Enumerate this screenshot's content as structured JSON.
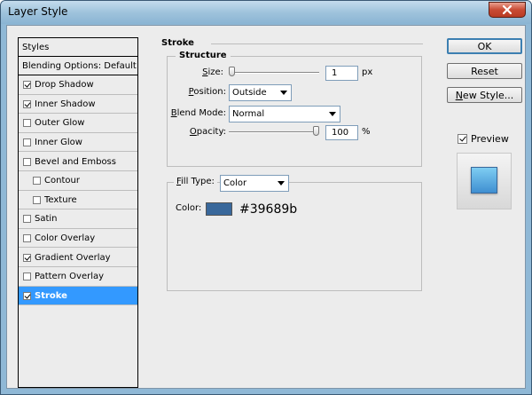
{
  "window": {
    "title": "Layer Style"
  },
  "sidebar": {
    "header": "Styles",
    "items": [
      {
        "label": "Blending Options: Default",
        "checkbox": false,
        "checked": false,
        "indent": 0,
        "selected": false
      },
      {
        "label": "Drop Shadow",
        "checkbox": true,
        "checked": true,
        "indent": 0,
        "selected": false
      },
      {
        "label": "Inner Shadow",
        "checkbox": true,
        "checked": true,
        "indent": 0,
        "selected": false
      },
      {
        "label": "Outer Glow",
        "checkbox": true,
        "checked": false,
        "indent": 0,
        "selected": false
      },
      {
        "label": "Inner Glow",
        "checkbox": true,
        "checked": false,
        "indent": 0,
        "selected": false
      },
      {
        "label": "Bevel and Emboss",
        "checkbox": true,
        "checked": false,
        "indent": 0,
        "selected": false
      },
      {
        "label": "Contour",
        "checkbox": true,
        "checked": false,
        "indent": 1,
        "selected": false
      },
      {
        "label": "Texture",
        "checkbox": true,
        "checked": false,
        "indent": 1,
        "selected": false
      },
      {
        "label": "Satin",
        "checkbox": true,
        "checked": false,
        "indent": 0,
        "selected": false
      },
      {
        "label": "Color Overlay",
        "checkbox": true,
        "checked": false,
        "indent": 0,
        "selected": false
      },
      {
        "label": "Gradient Overlay",
        "checkbox": true,
        "checked": true,
        "indent": 0,
        "selected": false
      },
      {
        "label": "Pattern Overlay",
        "checkbox": true,
        "checked": false,
        "indent": 0,
        "selected": false
      },
      {
        "label": "Stroke",
        "checkbox": true,
        "checked": true,
        "indent": 0,
        "selected": true
      }
    ]
  },
  "panel": {
    "title": "Stroke",
    "structure": {
      "title": "Structure",
      "size": {
        "label_pre": "",
        "label_u": "S",
        "label_post": "ize:",
        "value": "1",
        "unit": "px",
        "slider_fraction": 0.0
      },
      "position": {
        "label_pre": "",
        "label_u": "P",
        "label_post": "osition:",
        "value": "Outside"
      },
      "blend_mode": {
        "label_pre": "",
        "label_u": "B",
        "label_post": "lend Mode:",
        "value": "Normal"
      },
      "opacity": {
        "label_pre": "",
        "label_u": "O",
        "label_post": "pacity:",
        "value": "100",
        "unit": "%",
        "slider_fraction": 1.0
      }
    },
    "fill": {
      "type_label_pre": "",
      "type_label_u": "F",
      "type_label_post": "ill Type:",
      "type_value": "Color",
      "color_label": "Color:",
      "color_hex_text": "#39689b",
      "color_value": "#39689b"
    }
  },
  "buttons": {
    "ok": "OK",
    "reset": "Reset",
    "new_style_u": "N",
    "new_style_rest": "ew Style...",
    "preview_u": "V",
    "preview_pre": "",
    "preview_post": "",
    "preview_label": "Preview",
    "preview_checked": true
  },
  "colors": {
    "accent": "#3399ff",
    "stroke_color": "#39689b",
    "title_bar": "#9fc3dc"
  }
}
